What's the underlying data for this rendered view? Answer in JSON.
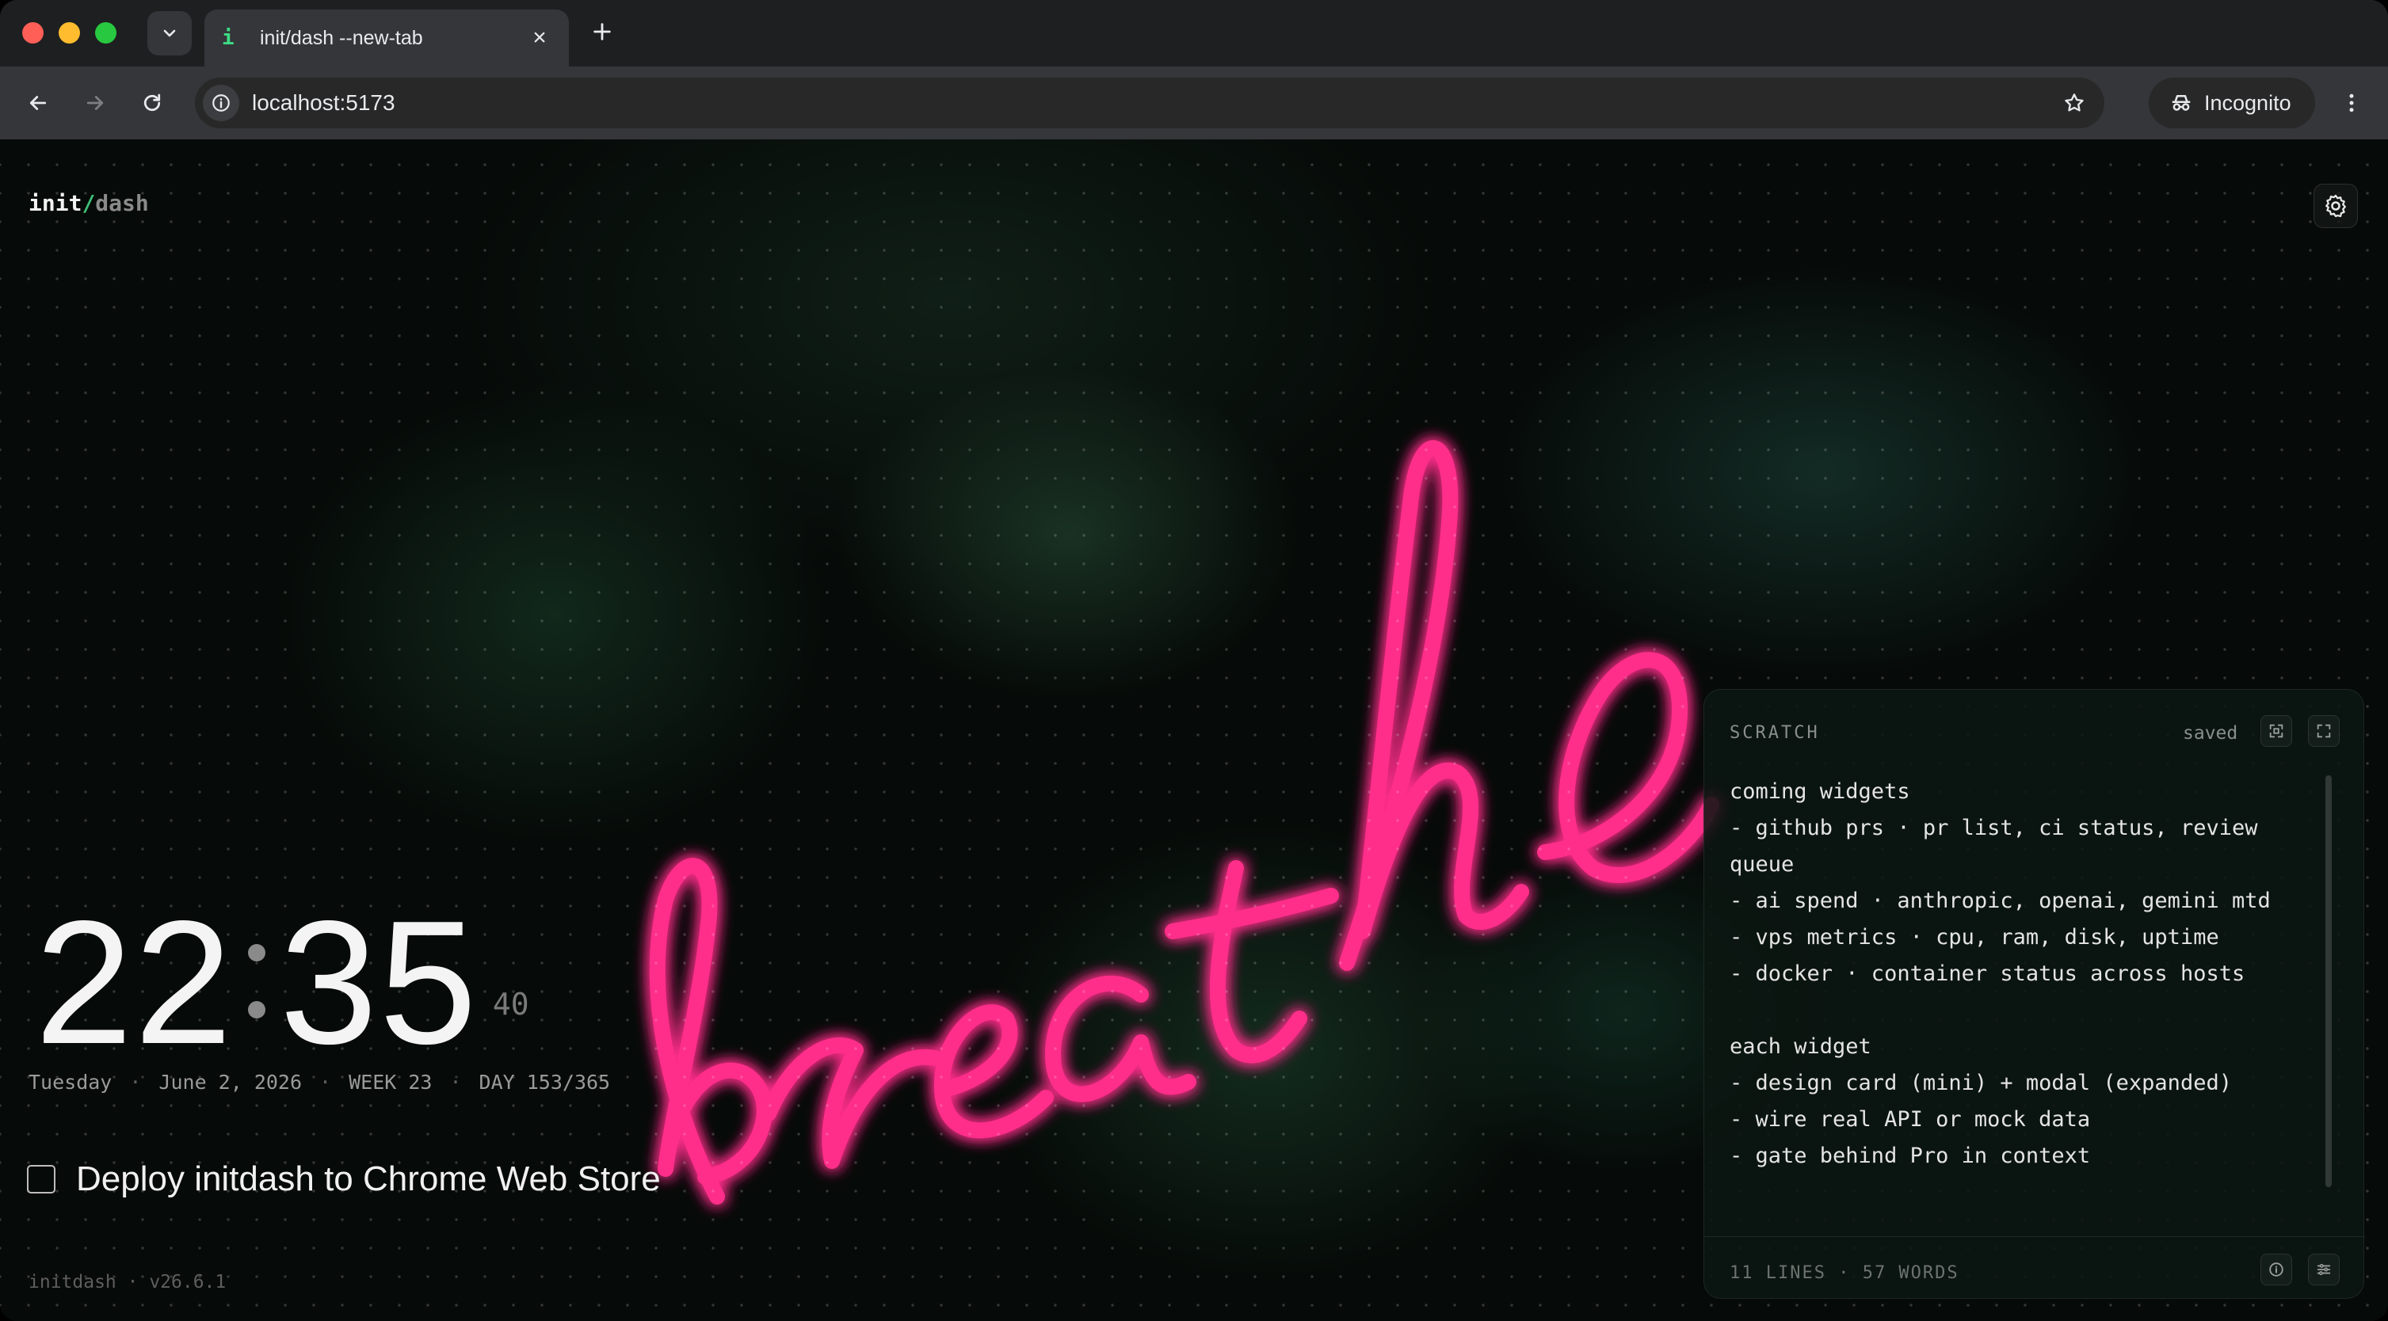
{
  "browser": {
    "tab_title": "init/dash --new-tab",
    "tab_favicon": "i",
    "url": "localhost:5173",
    "incognito_label": "Incognito",
    "icons": {
      "tab_search": "chevron-down-icon",
      "tab_close": "close-icon",
      "new_tab": "plus-icon",
      "back": "arrow-left-icon",
      "forward": "arrow-right-icon",
      "reload": "reload-icon",
      "site_info": "info-icon",
      "bookmark": "star-icon",
      "incognito": "incognito-icon",
      "menu": "kebab-menu-icon"
    }
  },
  "brand": {
    "part_a": "init",
    "slash": "/",
    "part_b": "dash"
  },
  "settings_icon": "gear-icon",
  "background": {
    "neon_text": "breathe",
    "neon_color": "#ff2d8a"
  },
  "clock": {
    "hours": "22",
    "minutes": "35",
    "seconds": "40",
    "weekday": "Tuesday",
    "date": "June 2, 2026",
    "week": "WEEK 23",
    "day_of_year": "DAY 153/365",
    "separator": "·"
  },
  "task": {
    "checked": false,
    "text": "Deploy initdash to Chrome Web Store"
  },
  "footer": {
    "text": "initdash · v26.6.1"
  },
  "scratch": {
    "title": "SCRATCH",
    "status": "saved",
    "icons": {
      "focus": "focus-mode-icon",
      "expand": "expand-icon",
      "info": "info-icon",
      "options": "sliders-icon"
    },
    "body": "coming widgets\n- github prs · pr list, ci status, review queue\n- ai spend · anthropic, openai, gemini mtd\n- vps metrics · cpu, ram, disk, uptime\n- docker · container status across hosts\n\neach widget\n- design card (mini) + modal (expanded)\n- wire real API or mock data\n- gate behind Pro in context",
    "stats": "11 LINES · 57 WORDS"
  },
  "colors": {
    "accent": "#3fbf78",
    "neon": "#ff2d8a"
  }
}
